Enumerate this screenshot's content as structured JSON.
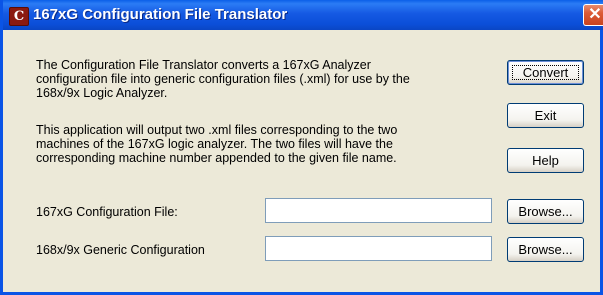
{
  "window": {
    "title": "167xG Configuration File Translator",
    "icon_letter": "C",
    "close_glyph": "✕"
  },
  "description": {
    "para1_line1": "The Configuration File Translator converts a 167xG Analyzer",
    "para1_line2": "configuration file into generic configuration files (.xml) for use by the",
    "para1_line3": "168x/9x Logic Analyzer.",
    "para2_line1": "This application will output two .xml files corresponding to the two",
    "para2_line2": "machines of the 167xG logic analyzer.  The two files will have the",
    "para2_line3": "corresponding machine number appended to the given file name."
  },
  "buttons": {
    "convert": "Convert",
    "exit": "Exit",
    "help": "Help",
    "browse1": "Browse...",
    "browse2": "Browse..."
  },
  "fields": {
    "config_file_label": "167xG Configuration File:",
    "config_file_value": "",
    "generic_config_label": "168x/9x Generic Configuration",
    "generic_config_value": ""
  },
  "icons": {
    "app_icon": "app-logo-icon",
    "close": "close-icon"
  }
}
